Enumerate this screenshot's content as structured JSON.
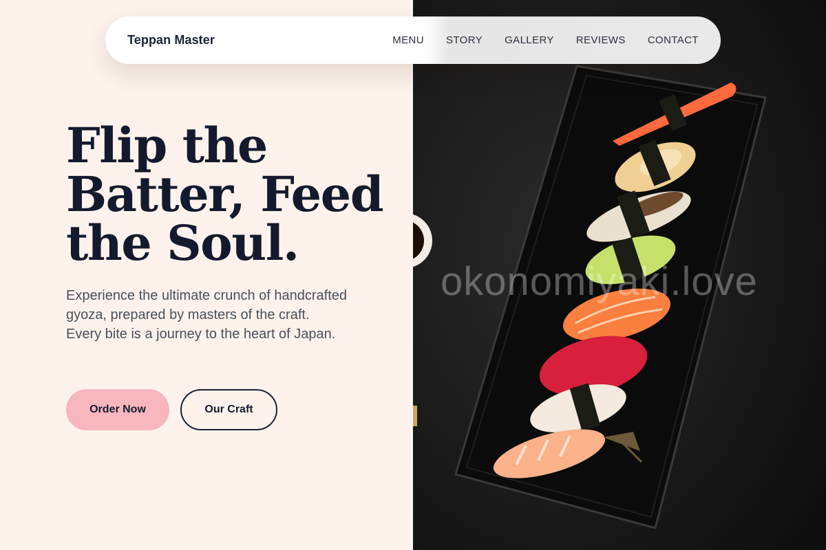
{
  "brand": {
    "name": "Teppan Master"
  },
  "nav": {
    "items": [
      {
        "label": "MENU"
      },
      {
        "label": "STORY"
      },
      {
        "label": "GALLERY"
      },
      {
        "label": "REVIEWS"
      },
      {
        "label": "CONTACT"
      }
    ]
  },
  "hero": {
    "title": "Flip the Batter, Feed the Soul.",
    "description": "Experience the ultimate crunch of handcrafted gyoza, prepared by masters of the craft. Every bite is a journey to the heart of Japan.",
    "primary_button": "Order Now",
    "secondary_button": "Our Craft"
  },
  "image": {
    "watermark": "okonomiyaki.love"
  },
  "colors": {
    "background": "#fdf3ec",
    "heading": "#141a2e",
    "body_text": "#4a4f5c",
    "primary_button": "#f8b6bf",
    "photo_background": "#121212"
  }
}
